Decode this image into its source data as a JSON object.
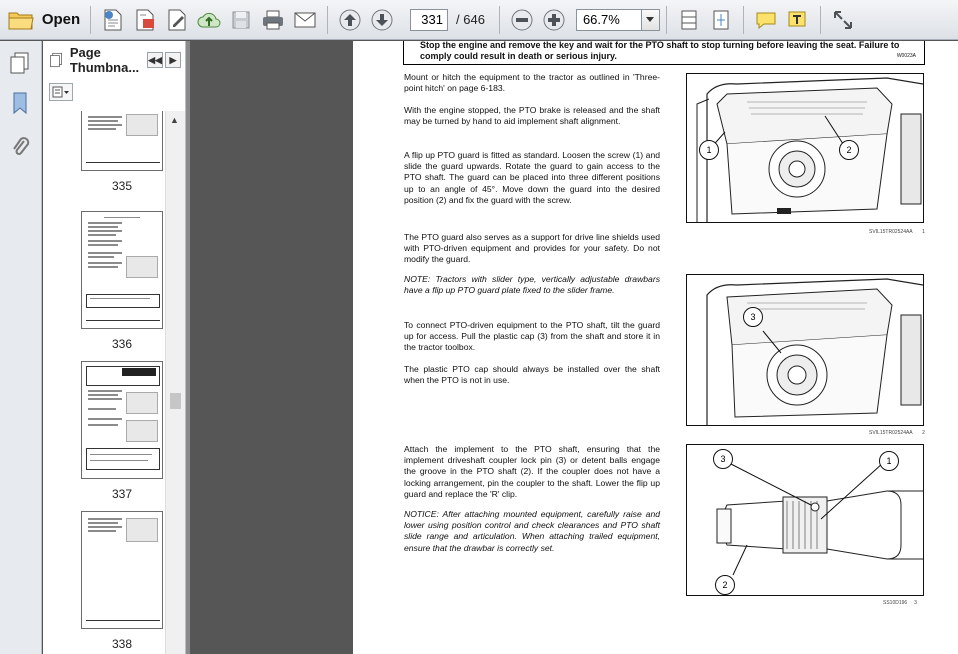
{
  "toolbar": {
    "open_label": "Open",
    "current_page": "331",
    "page_separator": "/",
    "total_pages": "646",
    "zoom": "66.7%"
  },
  "panel": {
    "title": "Page Thumbna...",
    "thumbnails": [
      {
        "label": "335"
      },
      {
        "label": "336"
      },
      {
        "label": "337"
      },
      {
        "label": "338"
      }
    ]
  },
  "document": {
    "warning_text": "Stop the engine and remove the key and wait for the PTO shaft to stop turning before leaving the seat. Failure to comply could result in death or serious injury.",
    "warning_code": "W0023A",
    "paragraphs": [
      "Mount or hitch the equipment to the tractor as outlined in 'Three-point hitch' on page 6-183.",
      "With the engine stopped, the PTO brake is released and the shaft may be turned by hand to aid implement shaft alignment.",
      "A flip up PTO guard is fitted as standard.  Loosen the screw (1) and slide the guard upwards. Rotate the guard to gain access to the PTO shaft. The guard can be placed into three different positions up to an angle of 45°.  Move down the guard into the desired position (2) and fix the guard with the screw.",
      "The PTO guard also serves as a support for drive line shields used with PTO-driven equipment and provides for your safety.  Do not modify the guard.",
      "NOTE: Tractors with slider type, vertically adjustable drawbars have a flip up PTO guard plate fixed to the slider frame.",
      "To connect PTO-driven equipment to the PTO shaft, tilt the guard up for access.  Pull the plastic cap (3) from the shaft and store it in the tractor toolbox.",
      "The plastic PTO cap should always be installed over the shaft when the PTO is not in use.",
      "Attach the implement to the PTO shaft, ensuring that the implement driveshaft coupler lock pin (3) or detent balls engage the groove in the PTO shaft (2).  If the coupler does not have a locking arrangement, pin the coupler to the shaft. Lower the flip up guard and replace the 'R' clip.",
      "NOTICE: After attaching mounted equipment, carefully raise and lower using position control and check clearances and PTO shaft slide range and articulation. When attaching trailed equipment, ensure that the drawbar is correctly set."
    ],
    "figures": [
      {
        "caption": "SVIL15TR02524AA",
        "index": "1",
        "callouts": [
          "1",
          "2"
        ]
      },
      {
        "caption": "SVIL15TR02524AA",
        "index": "2",
        "callouts": [
          "3"
        ]
      },
      {
        "caption": "SS10D196",
        "index": "3",
        "callouts": [
          "3",
          "1",
          "2"
        ]
      }
    ]
  }
}
